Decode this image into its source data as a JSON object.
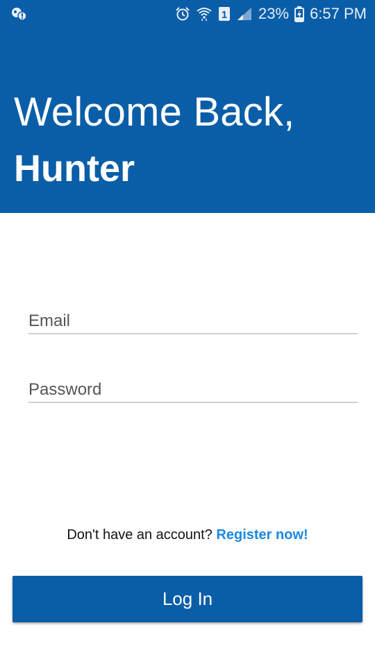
{
  "status_bar": {
    "battery_percent": "23%",
    "time": "6:57 PM",
    "sim_slot": "1",
    "icons": [
      "notification-icon",
      "alarm-icon",
      "wifi-icon",
      "sim-icon",
      "signal-icon",
      "battery-charging-icon"
    ]
  },
  "header": {
    "greeting": "Welcome Back,",
    "user_name": "Hunter",
    "background_color": "#0a5ea8"
  },
  "form": {
    "email": {
      "placeholder": "Email",
      "value": ""
    },
    "password": {
      "placeholder": "Password",
      "value": ""
    }
  },
  "register": {
    "prompt": "Don't have an account?",
    "link_label": "Register now!",
    "link_color": "#1a88e0"
  },
  "login_button": {
    "label": "Log In",
    "color": "#0a5ea8"
  }
}
